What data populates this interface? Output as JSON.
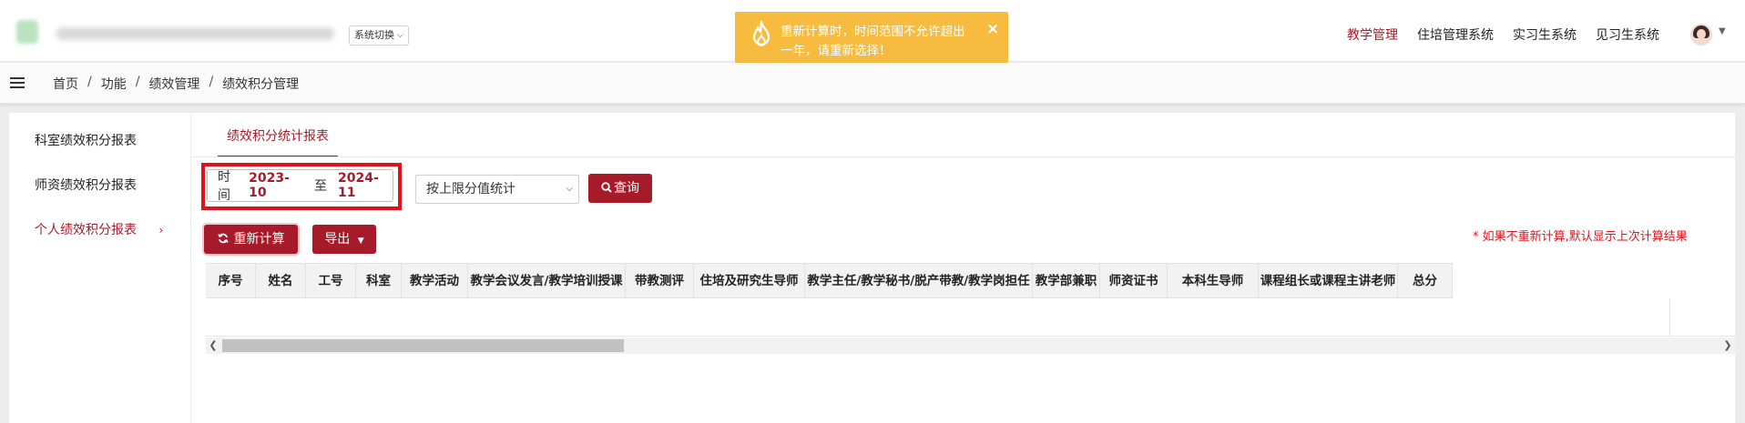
{
  "topbar": {
    "system_switch": "系统切换",
    "nav": [
      "教学管理",
      "住培管理系统",
      "实习生系统",
      "见习生系统"
    ],
    "active_nav_index": 0
  },
  "toast": {
    "message": "重新计算时，时间范围不允许超出一年，请重新选择！",
    "close": "×",
    "icon": "fire-icon",
    "color": "#f7bb3f"
  },
  "breadcrumb": {
    "items": [
      "首页",
      "功能",
      "绩效管理",
      "绩效积分管理"
    ],
    "separator": "/"
  },
  "sidebar": {
    "items": [
      {
        "label": "科室绩效积分报表"
      },
      {
        "label": "师资绩效积分报表"
      },
      {
        "label": "个人绩效积分报表",
        "arrow": "›"
      }
    ],
    "active_index": 2
  },
  "tabs": {
    "active": "绩效积分统计报表"
  },
  "filters": {
    "time_label": "时间",
    "start": "2023-10",
    "to_label": "至",
    "end": "2024-11",
    "mode_select": "按上限分值统计",
    "query_button": "查询"
  },
  "actions": {
    "recalculate": "重新计算",
    "export": "导出"
  },
  "note": "* 如果不重新计算,默认显示上次计算结果",
  "table": {
    "columns": [
      "序号",
      "姓名",
      "工号",
      "科室",
      "教学活动",
      "教学会议发言/教学培训授课",
      "带教测评",
      "住培及研究生导师",
      "教学主任/教学秘书/脱产带教/教学岗担任",
      "教学部兼职",
      "师资证书",
      "本科生导师",
      "课程组长或课程主讲老师",
      "总分"
    ],
    "rows": []
  },
  "colors": {
    "brand": "#a61b29",
    "highlight_border": "#e0131a"
  }
}
